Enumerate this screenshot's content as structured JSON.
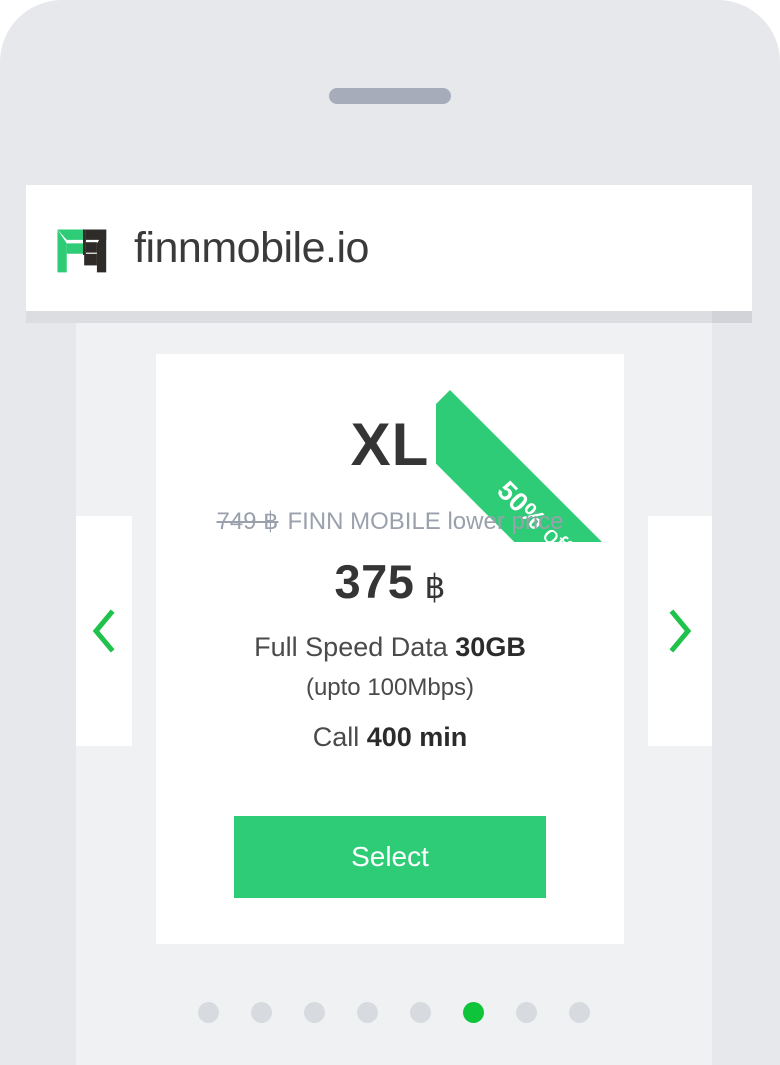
{
  "device": {
    "speaker_name": "speaker-grille"
  },
  "header": {
    "brand_name": "finnmobile.io",
    "logo_name": "finnmobile-logo"
  },
  "carousel": {
    "prev_label": "‹",
    "next_label": "›",
    "dots": [
      {
        "active": false
      },
      {
        "active": false
      },
      {
        "active": false
      },
      {
        "active": false
      },
      {
        "active": false
      },
      {
        "active": true
      },
      {
        "active": false
      },
      {
        "active": false
      }
    ],
    "active_index": 5,
    "total": 8
  },
  "plan": {
    "ribbon_percent": "50%",
    "ribbon_off": "off",
    "title": "XL",
    "old_price": "749 ฿",
    "compare_label": "FINN MOBILE lower price",
    "price_amount": "375",
    "price_currency": "฿",
    "data_prefix": "Full Speed Data ",
    "data_value": "30GB",
    "speed_note": "(upto 100Mbps)",
    "call_prefix": "Call ",
    "call_value": "400 min",
    "select_label": "Select"
  },
  "colors": {
    "brand_green": "#2ecc77",
    "accent_green": "#0ec43a",
    "arrow_green": "#1fc24a",
    "device_body": "#e6e8ec",
    "screen_bg": "#f0f1f3",
    "card_bg": "#ffffff",
    "text_dark": "#353535",
    "text_muted": "#9aa1ac"
  }
}
